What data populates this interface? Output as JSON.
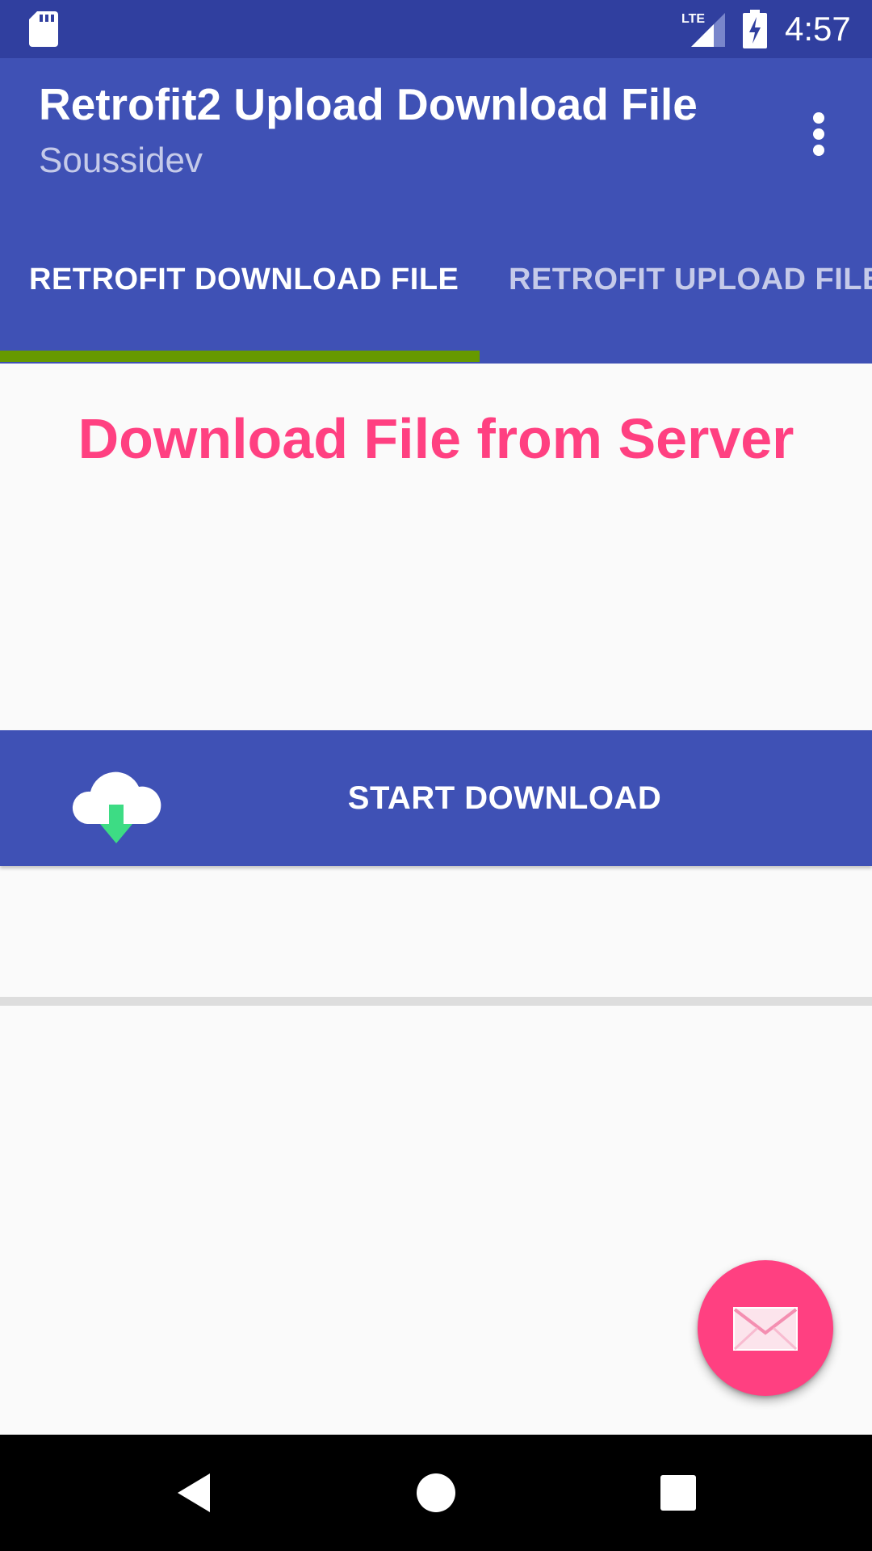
{
  "status_bar": {
    "time": "4:57",
    "network": "LTE",
    "icons": [
      "sd-card-icon",
      "lte-signal-icon",
      "battery-charging-icon"
    ]
  },
  "app_bar": {
    "title": "Retrofit2 Upload Download File",
    "subtitle": "Soussidev",
    "menu_icon": "more-vert-icon"
  },
  "tabs": [
    {
      "label": "RETROFIT DOWNLOAD FILE",
      "selected": true
    },
    {
      "label": "RETROFIT UPLOAD FILE",
      "selected": false
    }
  ],
  "main": {
    "heading": "Download File from Server",
    "download_button": {
      "label": "START DOWNLOAD",
      "icon": "cloud-download-icon"
    }
  },
  "fab": {
    "icon": "mail-icon"
  },
  "nav_bar": {
    "buttons": [
      "back-icon",
      "home-icon",
      "recents-icon"
    ]
  },
  "colors": {
    "primary": "#3f51b5",
    "primary_dark": "#303f9f",
    "accent": "#ff4081",
    "tab_indicator": "#669900",
    "subtitle": "#c5cae9",
    "background": "#fafafa"
  }
}
